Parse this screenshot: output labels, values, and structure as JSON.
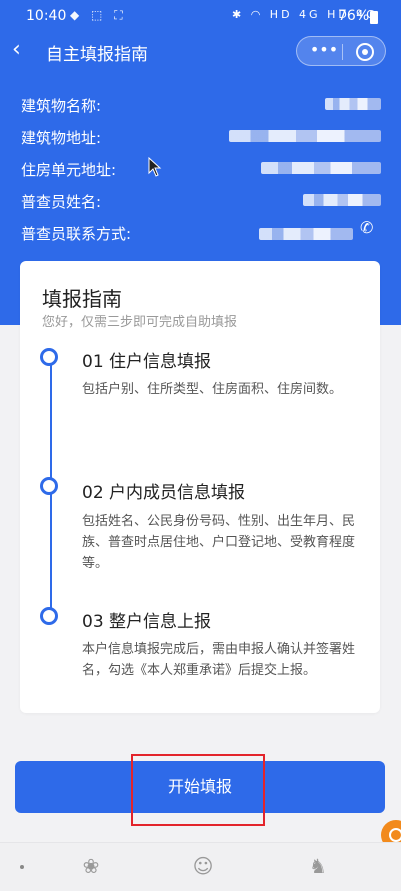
{
  "status_bar": {
    "time": "10:40",
    "left_icons": "◆ ⬚ ⛶",
    "right_icons": "✱ ◠ HD 4G HD 4G",
    "battery": "76%"
  },
  "nav": {
    "title": "自主填报指南",
    "back_icon": "chevron-left-icon",
    "more_icon": "more-dots-icon",
    "target_icon": "target-icon"
  },
  "info": {
    "building_name_label": "建筑物名称:",
    "building_address_label": "建筑物地址:",
    "unit_address_label": "住房单元地址:",
    "enumerator_name_label": "普查员姓名:",
    "enumerator_contact_label": "普查员联系方式:"
  },
  "guide": {
    "title": "填报指南",
    "subtitle": "您好，仅需三步即可完成自助填报",
    "steps": [
      {
        "title": "01 住户信息填报",
        "desc": "包括户别、住所类型、住房面积、住房间数。"
      },
      {
        "title": "02 户内成员信息填报",
        "desc": "包括姓名、公民身份号码、性别、出生年月、民族、普查时点居住地、户口登记地、受教育程度等。"
      },
      {
        "title": "03 整户信息上报",
        "desc": "本户信息填报完成后，需由申报人确认并签署姓名，勾选《本人郑重承诺》后提交上报。"
      }
    ]
  },
  "actions": {
    "start_label": "开始填报"
  },
  "colors": {
    "primary": "#2e6ae9",
    "highlight": "#e3242b",
    "background": "#f2f2f4"
  }
}
